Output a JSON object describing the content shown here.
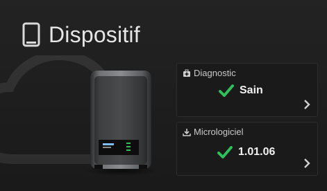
{
  "header": {
    "title": "Dispositif",
    "icon": "device-icon"
  },
  "cards": [
    {
      "label": "Diagnostic",
      "icon": "health-icon",
      "status": "Sain",
      "status_icon": "check-icon"
    },
    {
      "label": "Micrologiciel",
      "icon": "download-icon",
      "status": "1.01.06",
      "status_icon": "check-icon"
    }
  ],
  "colors": {
    "accent_green": "#2fbf5b",
    "background": "#1f1f1f",
    "card_background": "#1a1a1a"
  }
}
